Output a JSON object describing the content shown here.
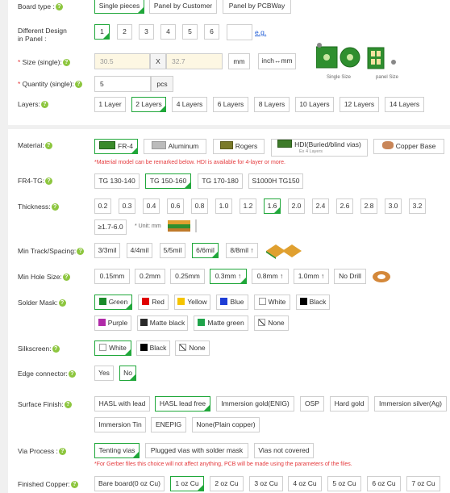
{
  "board_type": {
    "label": "Board type :",
    "options": [
      "Single pieces",
      "Panel by Customer",
      "Panel by PCBWay"
    ],
    "selected": "Single pieces"
  },
  "different_design": {
    "label_line1": "Different Design",
    "label_line2": "in Panel :",
    "options": [
      "1",
      "2",
      "3",
      "4",
      "5",
      "6"
    ],
    "selected": "1",
    "input_value": "",
    "example_link": "e.g."
  },
  "size": {
    "label": "Size (single):",
    "width_value": "30.5",
    "x_sep": "X",
    "height_value": "32.7",
    "unit": "mm",
    "toggle_label": "inch↔mm",
    "caption_single": "Single Size",
    "caption_panel": "panel Size"
  },
  "quantity": {
    "label": "Quantity (single):",
    "value": "5",
    "unit": "pcs"
  },
  "layers": {
    "label": "Layers:",
    "options": [
      "1 Layer",
      "2 Layers",
      "4 Layers",
      "6 Layers",
      "8 Layers",
      "10 Layers",
      "12 Layers",
      "14 Layers"
    ],
    "selected": "2 Layers"
  },
  "material": {
    "label": "Material:",
    "options": [
      "FR-4",
      "Aluminum",
      "Rogers",
      "HDI(Buried/blind vias)",
      "Copper Base"
    ],
    "hdi_sub": "Ex 4 Layers",
    "selected": "FR-4",
    "note": "*Material model can be remarked below. HDI is available for 4-layer or more."
  },
  "fr4_tg": {
    "label": "FR4-TG:",
    "options": [
      "TG 130-140",
      "TG 150-160",
      "TG 170-180",
      "S1000H TG150"
    ],
    "selected": "TG 150-160"
  },
  "thickness": {
    "label": "Thickness:",
    "options": [
      "0.2",
      "0.3",
      "0.4",
      "0.6",
      "0.8",
      "1.0",
      "1.2",
      "1.6",
      "2.0",
      "2.4",
      "2.6",
      "2.8",
      "3.0",
      "3.2",
      "≥1.7-6.0"
    ],
    "selected": "1.6",
    "unit_note": "* Unit: mm"
  },
  "min_track": {
    "label": "Min Track/Spacing:",
    "options": [
      "3/3mil",
      "4/4mil",
      "5/5mil",
      "6/6mil",
      "8/8mil ↑"
    ],
    "selected": "6/6mil"
  },
  "min_hole": {
    "label": "Min Hole Size:",
    "options": [
      "0.15mm",
      "0.2mm",
      "0.25mm",
      "0.3mm ↑",
      "0.8mm ↑",
      "1.0mm ↑",
      "No Drill"
    ],
    "selected": "0.3mm ↑"
  },
  "solder_mask": {
    "label": "Solder Mask:",
    "options": [
      {
        "name": "Green",
        "color": "#1a8a2a"
      },
      {
        "name": "Red",
        "color": "#e00000"
      },
      {
        "name": "Yellow",
        "color": "#f5c400"
      },
      {
        "name": "Blue",
        "color": "#1e3ed6"
      },
      {
        "name": "White",
        "color": "#ffffff"
      },
      {
        "name": "Black",
        "color": "#000000"
      },
      {
        "name": "Purple",
        "color": "#b02aa8"
      },
      {
        "name": "Matte black",
        "color": "#2a2a2a"
      },
      {
        "name": "Matte green",
        "color": "#1fa34a"
      },
      {
        "name": "None",
        "color": "#ffffff"
      }
    ],
    "selected": "Green"
  },
  "silkscreen": {
    "label": "Silkscreen:",
    "options": [
      {
        "name": "White",
        "color": "#ffffff"
      },
      {
        "name": "Black",
        "color": "#000000"
      },
      {
        "name": "None",
        "color": "#ffffff"
      }
    ],
    "selected": "White"
  },
  "edge_connector": {
    "label": "Edge connector:",
    "options": [
      "Yes",
      "No"
    ],
    "selected": "No"
  },
  "surface_finish": {
    "label": "Surface Finish:",
    "options": [
      "HASL with lead",
      "HASL lead free",
      "Immersion gold(ENIG)",
      "OSP",
      "Hard gold",
      "Immersion silver(Ag)",
      "Immersion Tin",
      "ENEPIG",
      "None(Plain copper)"
    ],
    "selected": "HASL lead free"
  },
  "via_process": {
    "label": "Via Process :",
    "options": [
      "Tenting vias",
      "Plugged vias with solder mask",
      "Vias not covered"
    ],
    "selected": "Tenting vias",
    "note": "*For Gerber files this choice will not affect anything, PCB will be made using the parameters of the files."
  },
  "finished_copper": {
    "label": "Finished Copper:",
    "options": [
      "Bare board(0 oz Cu)",
      "1 oz Cu",
      "2 oz Cu",
      "3 oz Cu",
      "4 oz Cu",
      "5 oz Cu",
      "6 oz Cu",
      "7 oz Cu"
    ],
    "selected": "1 oz Cu"
  },
  "colors": {
    "accent": "#20a73a",
    "required": "#e4393c",
    "help_icon": "#8dc63f"
  }
}
